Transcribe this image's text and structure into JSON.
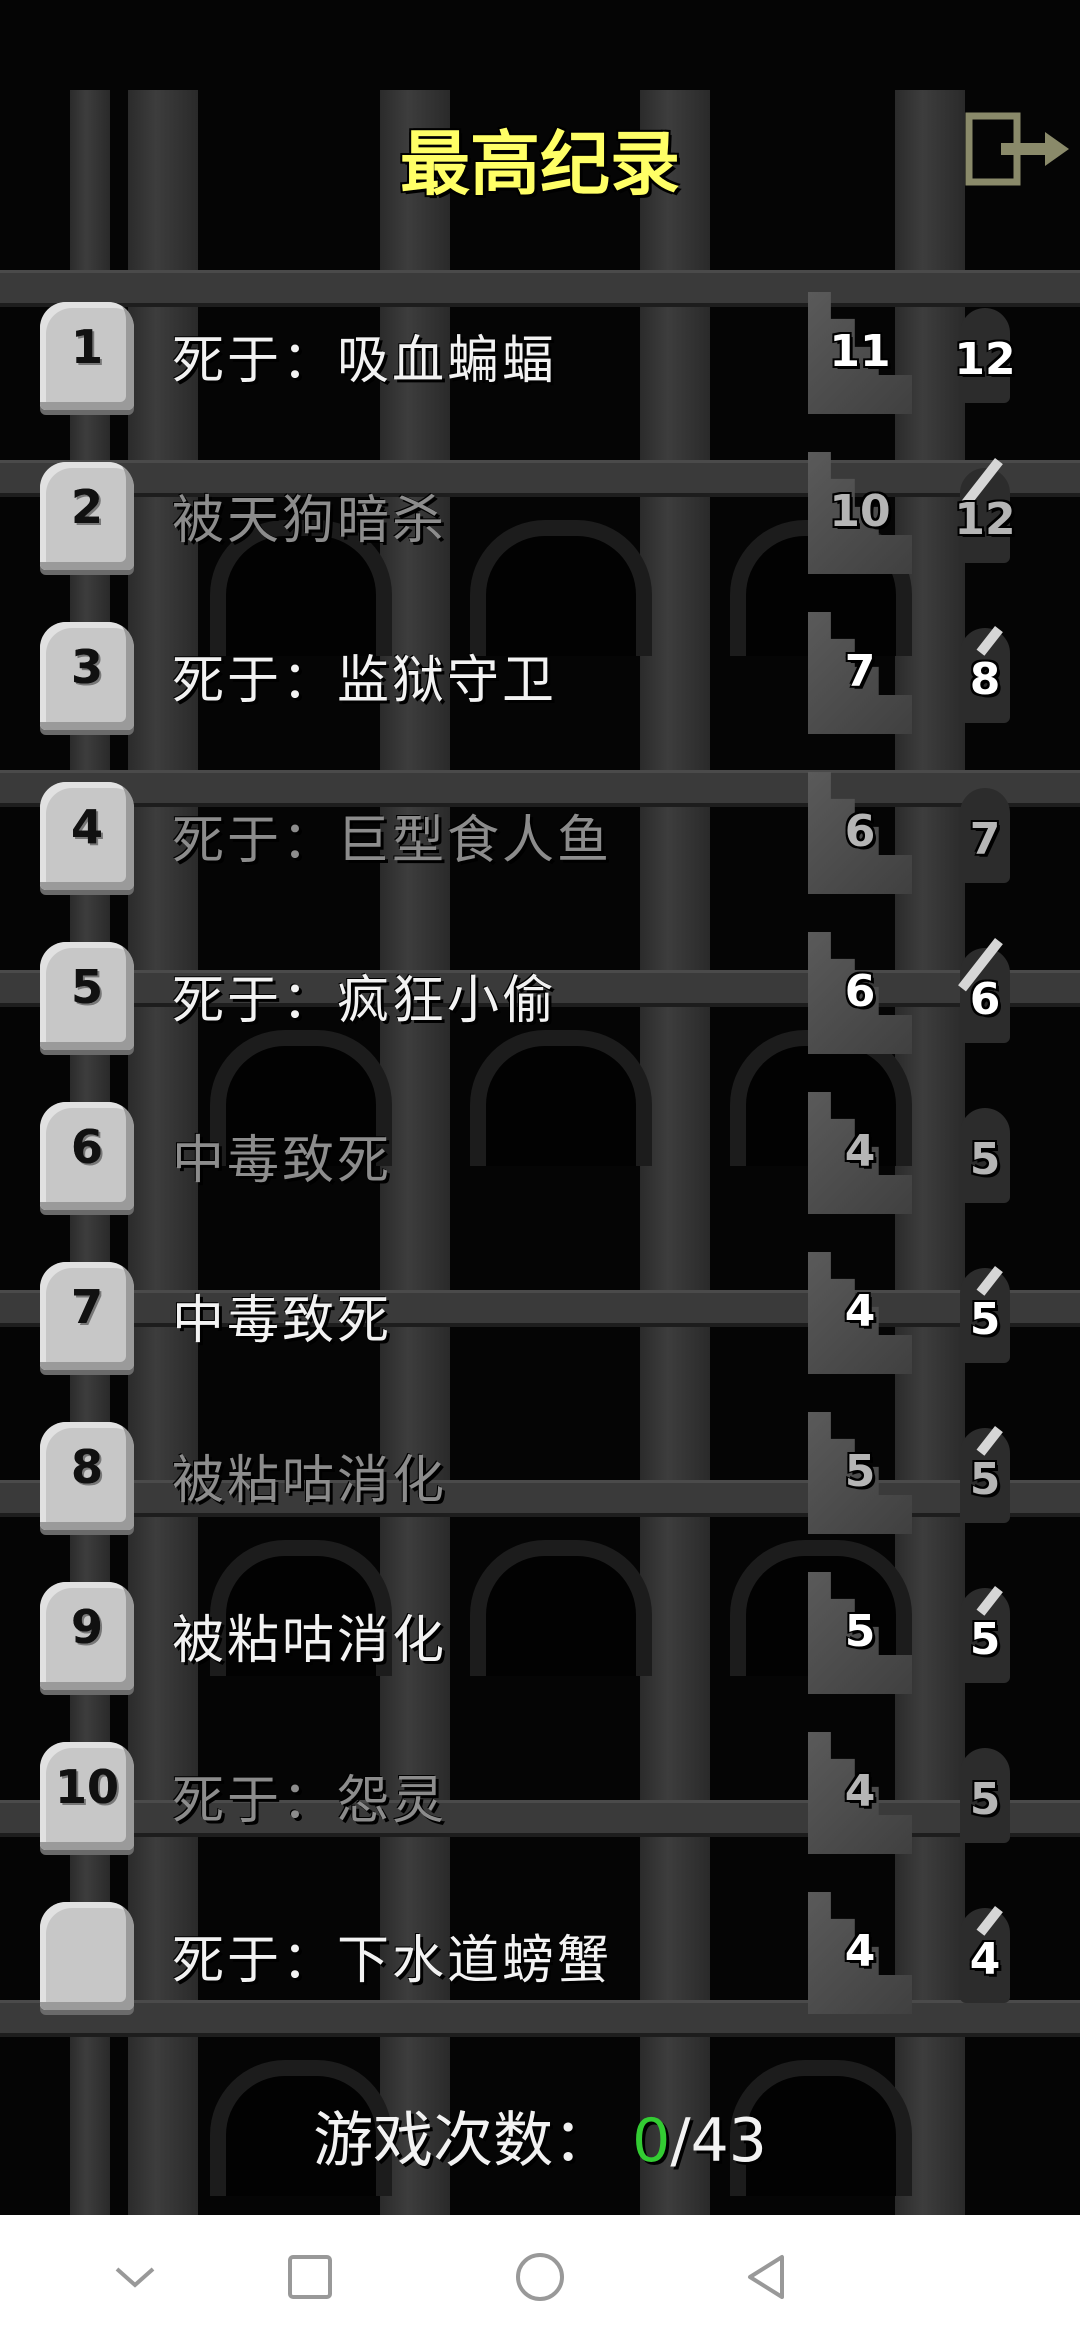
{
  "header": {
    "title": "最高纪录",
    "exit_icon": "exit-icon"
  },
  "records": [
    {
      "rank": "1",
      "cause": "死于：吸血蝙蝠",
      "depth": "11",
      "level": "12",
      "hero": "warrior",
      "faded": false
    },
    {
      "rank": "2",
      "cause": "被天狗暗杀",
      "depth": "10",
      "level": "12",
      "hero": "rogue",
      "faded": true
    },
    {
      "rank": "3",
      "cause": "死于：监狱守卫",
      "depth": "7",
      "level": "8",
      "hero": "mage",
      "faded": false
    },
    {
      "rank": "4",
      "cause": "死于：巨型食人鱼",
      "depth": "6",
      "level": "7",
      "hero": "warrior",
      "faded": true
    },
    {
      "rank": "5",
      "cause": "死于：疯狂小偷",
      "depth": "6",
      "level": "6",
      "hero": "rogue",
      "faded": false
    },
    {
      "rank": "6",
      "cause": "中毒致死",
      "depth": "4",
      "level": "5",
      "hero": "warrior",
      "faded": true
    },
    {
      "rank": "7",
      "cause": "中毒致死",
      "depth": "4",
      "level": "5",
      "hero": "mage",
      "faded": false
    },
    {
      "rank": "8",
      "cause": "被粘咕消化",
      "depth": "5",
      "level": "5",
      "hero": "mage",
      "faded": true
    },
    {
      "rank": "9",
      "cause": "被粘咕消化",
      "depth": "5",
      "level": "5",
      "hero": "mage",
      "faded": false
    },
    {
      "rank": "10",
      "cause": "死于：怨灵",
      "depth": "4",
      "level": "5",
      "hero": "warrior",
      "faded": true
    },
    {
      "rank": "",
      "cause": "死于：下水道螃蟹",
      "depth": "4",
      "level": "4",
      "hero": "mage",
      "faded": false
    }
  ],
  "footer": {
    "label": "游戏次数：",
    "won": "0",
    "separator": "/",
    "total": "43"
  },
  "navbar": {
    "icons": [
      "chevron-down-icon",
      "square-icon",
      "circle-icon",
      "back-triangle-icon"
    ]
  },
  "colors": {
    "title": "#ffff66",
    "won": "#33cc33",
    "text": "#f2f2f2",
    "faded_text": "#8c8c8c"
  }
}
